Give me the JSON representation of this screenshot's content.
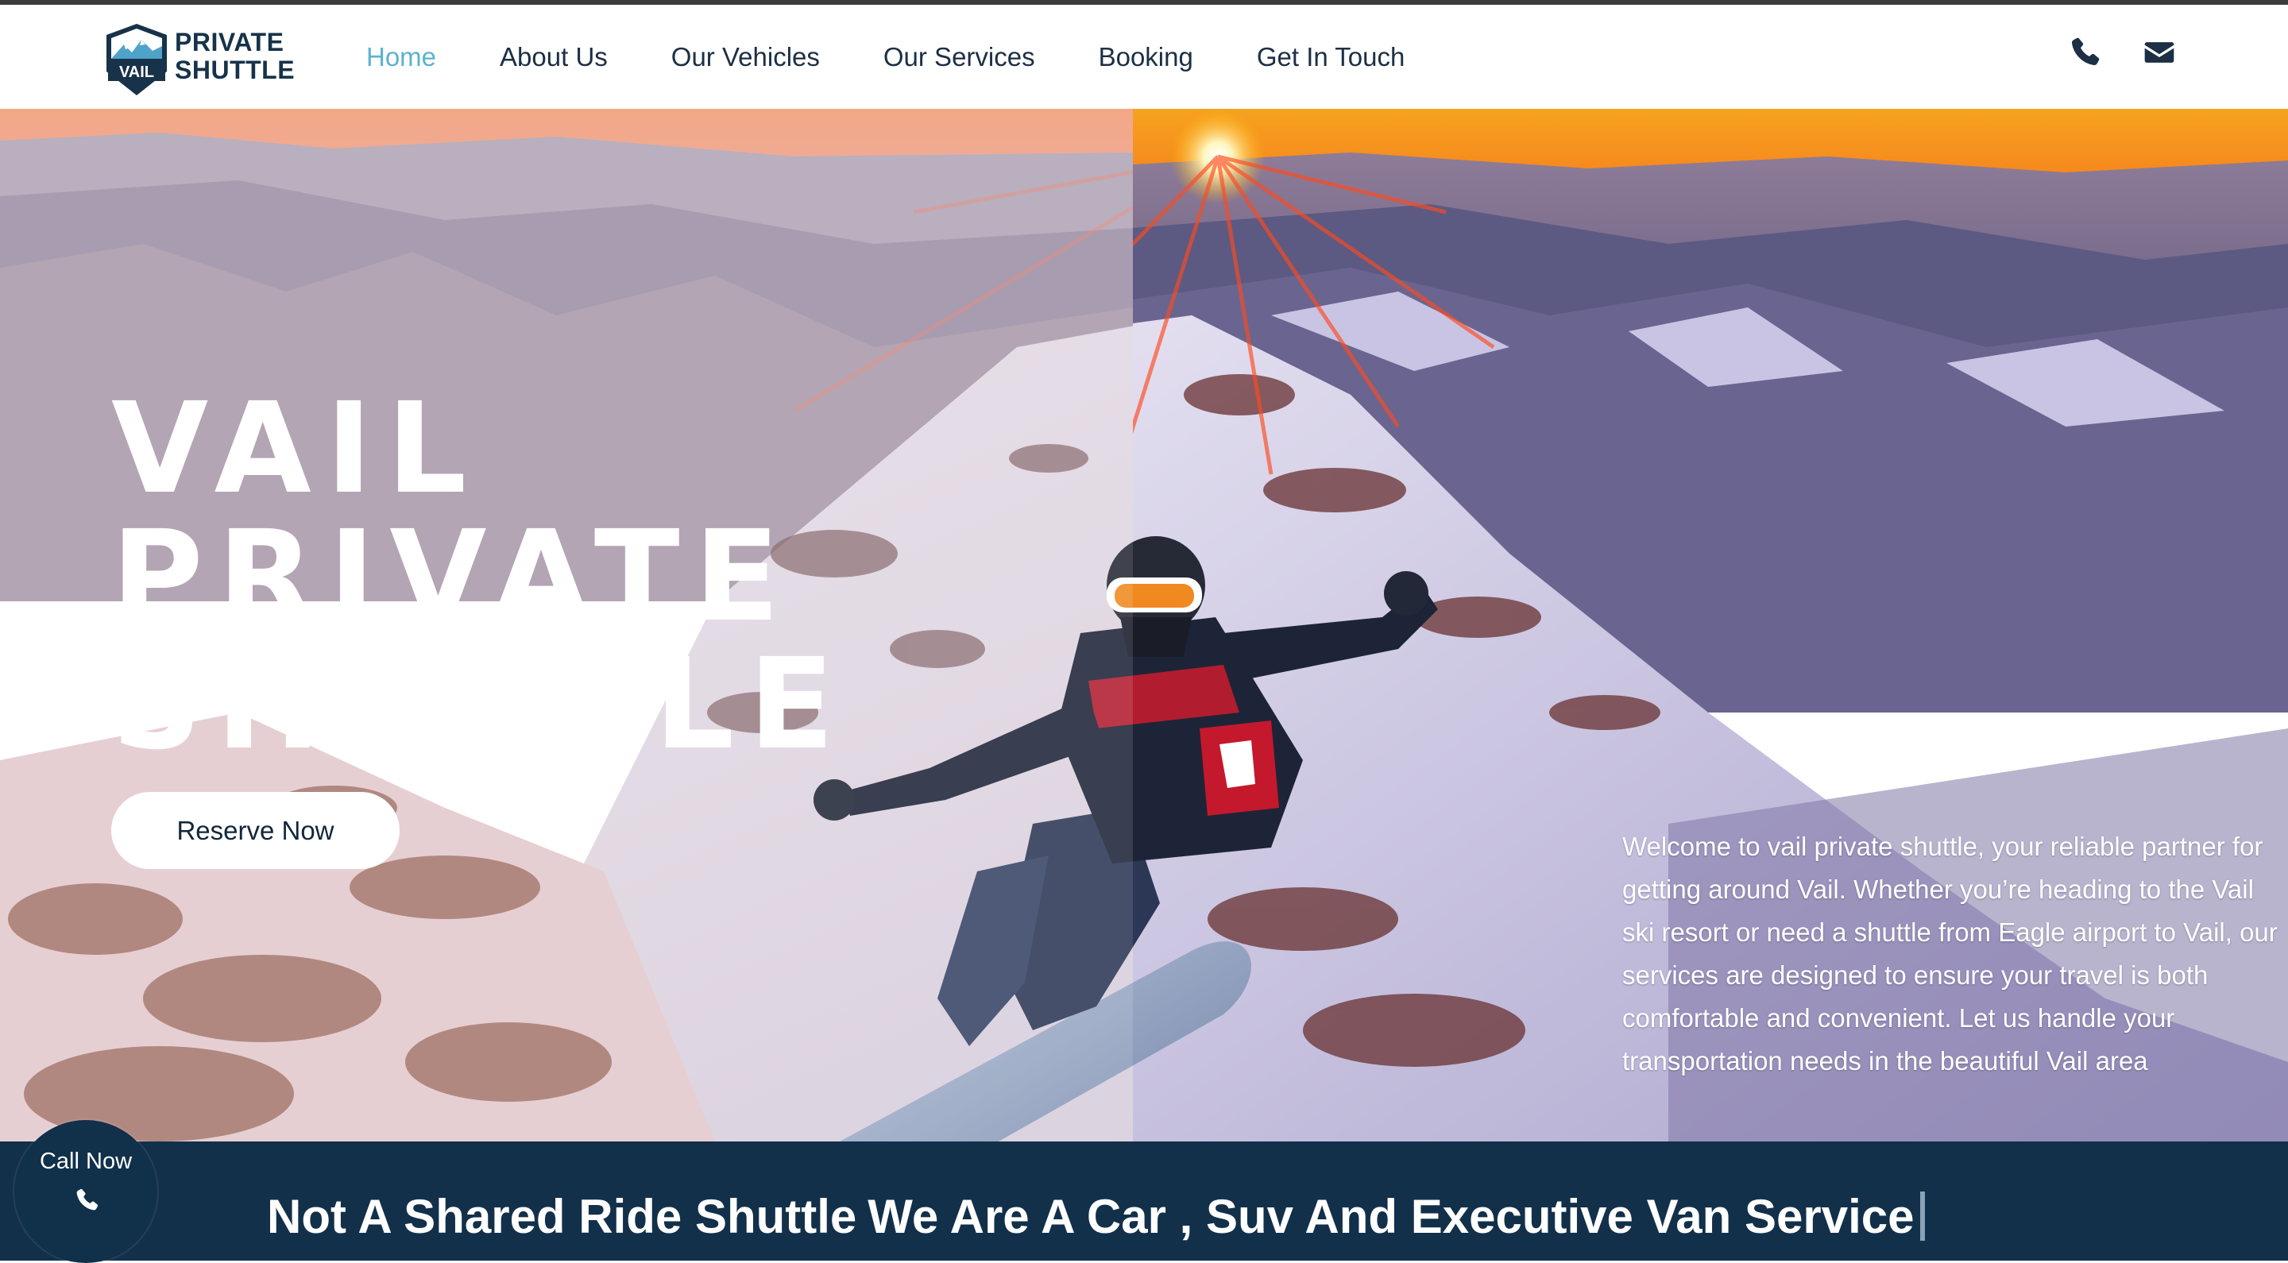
{
  "header": {
    "logo": {
      "badge_text": "VAIL",
      "line1": "PRIVATE",
      "line2": "SHUTTLE"
    },
    "nav": [
      {
        "label": "Home",
        "active": true
      },
      {
        "label": "About Us",
        "active": false
      },
      {
        "label": "Our Vehicles",
        "active": false
      },
      {
        "label": "Our Services",
        "active": false
      },
      {
        "label": "Booking",
        "active": false
      },
      {
        "label": "Get In Touch",
        "active": false
      }
    ],
    "icons": [
      "phone-icon",
      "envelope-icon"
    ]
  },
  "hero": {
    "title_lines": [
      "VAIL",
      "PRIVATE",
      "SHUTTLE"
    ],
    "cta_label": "Reserve Now",
    "welcome_text": "Welcome to vail private shuttle, your reliable partner for getting around Vail. Whether you’re heading to the Vail ski resort or need a shuttle from Eagle airport to Vail, our services are designed to ensure your travel is both comfortable and convenient. Let us handle your transportation needs in the beautiful Vail area"
  },
  "bottom_bar": {
    "tagline_part1": "Not A Shared Ride Shuttle",
    "tagline_part2": "We Are A Car , Suv  And Executive Van Service"
  },
  "call_now": {
    "label": "Call Now",
    "icon": "phone-icon"
  },
  "colors": {
    "nav_active": "#5bb2cf",
    "nav_text": "#1c2f44",
    "bottom_bar": "#12304a",
    "cta_background": "#ffffff"
  }
}
